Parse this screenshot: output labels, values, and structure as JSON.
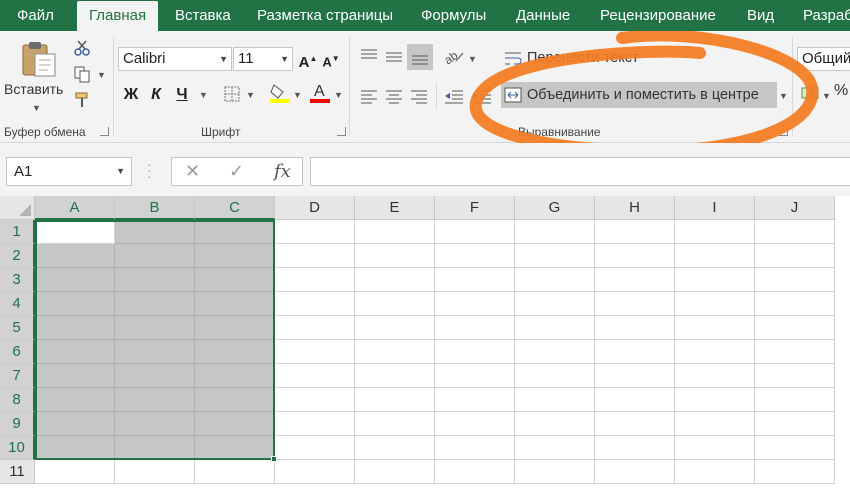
{
  "tabs": [
    {
      "label": "Файл",
      "active": false
    },
    {
      "label": "Главная",
      "active": true
    },
    {
      "label": "Вставка",
      "active": false
    },
    {
      "label": "Разметка страницы",
      "active": false
    },
    {
      "label": "Формулы",
      "active": false
    },
    {
      "label": "Данные",
      "active": false
    },
    {
      "label": "Рецензирование",
      "active": false
    },
    {
      "label": "Вид",
      "active": false
    },
    {
      "label": "Разраб",
      "active": false
    }
  ],
  "clipboard": {
    "paste_label": "Вставить",
    "group_label": "Буфер обмена"
  },
  "font": {
    "name": "Calibri",
    "size": "11",
    "bold": "Ж",
    "italic": "К",
    "underline": "Ч",
    "group_label": "Шрифт",
    "fill_color": "#FFFF00",
    "font_color": "#FF0000"
  },
  "alignment": {
    "wrap_text_label": "Перенести текст",
    "merge_center_label": "Объединить и поместить в центре",
    "group_label": "Выравнивание"
  },
  "number": {
    "format": "Общий",
    "percent": "%"
  },
  "formula_bar": {
    "name_box": "A1",
    "cancel": "✕",
    "enter": "✓",
    "fx": "fx",
    "value": ""
  },
  "sheet": {
    "columns": [
      "A",
      "B",
      "C",
      "D",
      "E",
      "F",
      "G",
      "H",
      "I",
      "J"
    ],
    "rows": [
      "1",
      "2",
      "3",
      "4",
      "5",
      "6",
      "7",
      "8",
      "9",
      "10",
      "11"
    ],
    "selected_range": "A1:C10",
    "active_cell": "A1"
  },
  "colors": {
    "accent": "#217346",
    "annotation": "#F47B20",
    "selection_fill": "#C6C6C6"
  }
}
